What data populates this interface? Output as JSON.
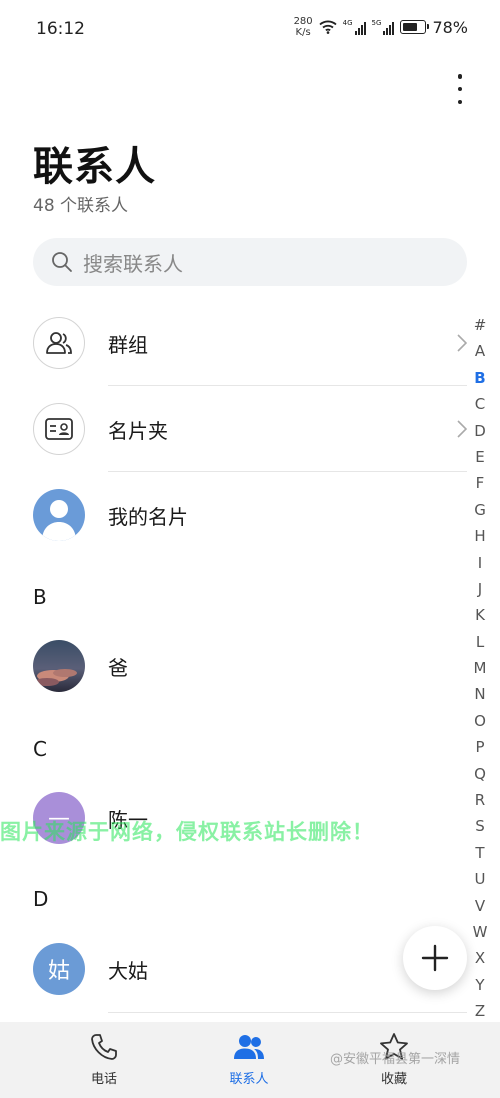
{
  "status_bar": {
    "time": "16:12",
    "net_speed_value": "280",
    "net_speed_unit": "K/s",
    "signal_1_label": "4G",
    "signal_2_label": "5G",
    "battery_percent": "78%",
    "battery_level": 0.78
  },
  "header": {
    "title": "联系人",
    "subtitle": "48 个联系人"
  },
  "search": {
    "placeholder": "搜索联系人"
  },
  "shortcuts": [
    {
      "label": "群组"
    },
    {
      "label": "名片夹"
    },
    {
      "label": "我的名片"
    }
  ],
  "sections": [
    {
      "header": "B",
      "contacts": [
        {
          "name": "爸"
        }
      ]
    },
    {
      "header": "C",
      "contacts": [
        {
          "name": "陈一",
          "avatar_text": "—",
          "avatar_color": "#a98fd9"
        }
      ]
    },
    {
      "header": "D",
      "contacts": [
        {
          "name": "大姑",
          "avatar_text": "姑",
          "avatar_color": "#6b9bd6"
        }
      ]
    }
  ],
  "alpha_index": [
    "#",
    "A",
    "B",
    "C",
    "D",
    "E",
    "F",
    "G",
    "H",
    "I",
    "J",
    "K",
    "L",
    "M",
    "N",
    "O",
    "P",
    "Q",
    "R",
    "S",
    "T",
    "U",
    "V",
    "W",
    "X",
    "Y",
    "Z"
  ],
  "alpha_active": "B",
  "watermark_text": "图片来源于网络，侵权联系站长删除！",
  "credit_text": "@安徽平福县第一深情",
  "bottom_nav": [
    {
      "label": "电话",
      "icon": "phone-icon"
    },
    {
      "label": "联系人",
      "icon": "contacts-icon",
      "active": true
    },
    {
      "label": "收藏",
      "icon": "star-icon"
    }
  ],
  "colors": {
    "accent": "#1f6fe5",
    "avatar_default": "#6a9bd8",
    "search_bg": "#f1f3f5"
  }
}
